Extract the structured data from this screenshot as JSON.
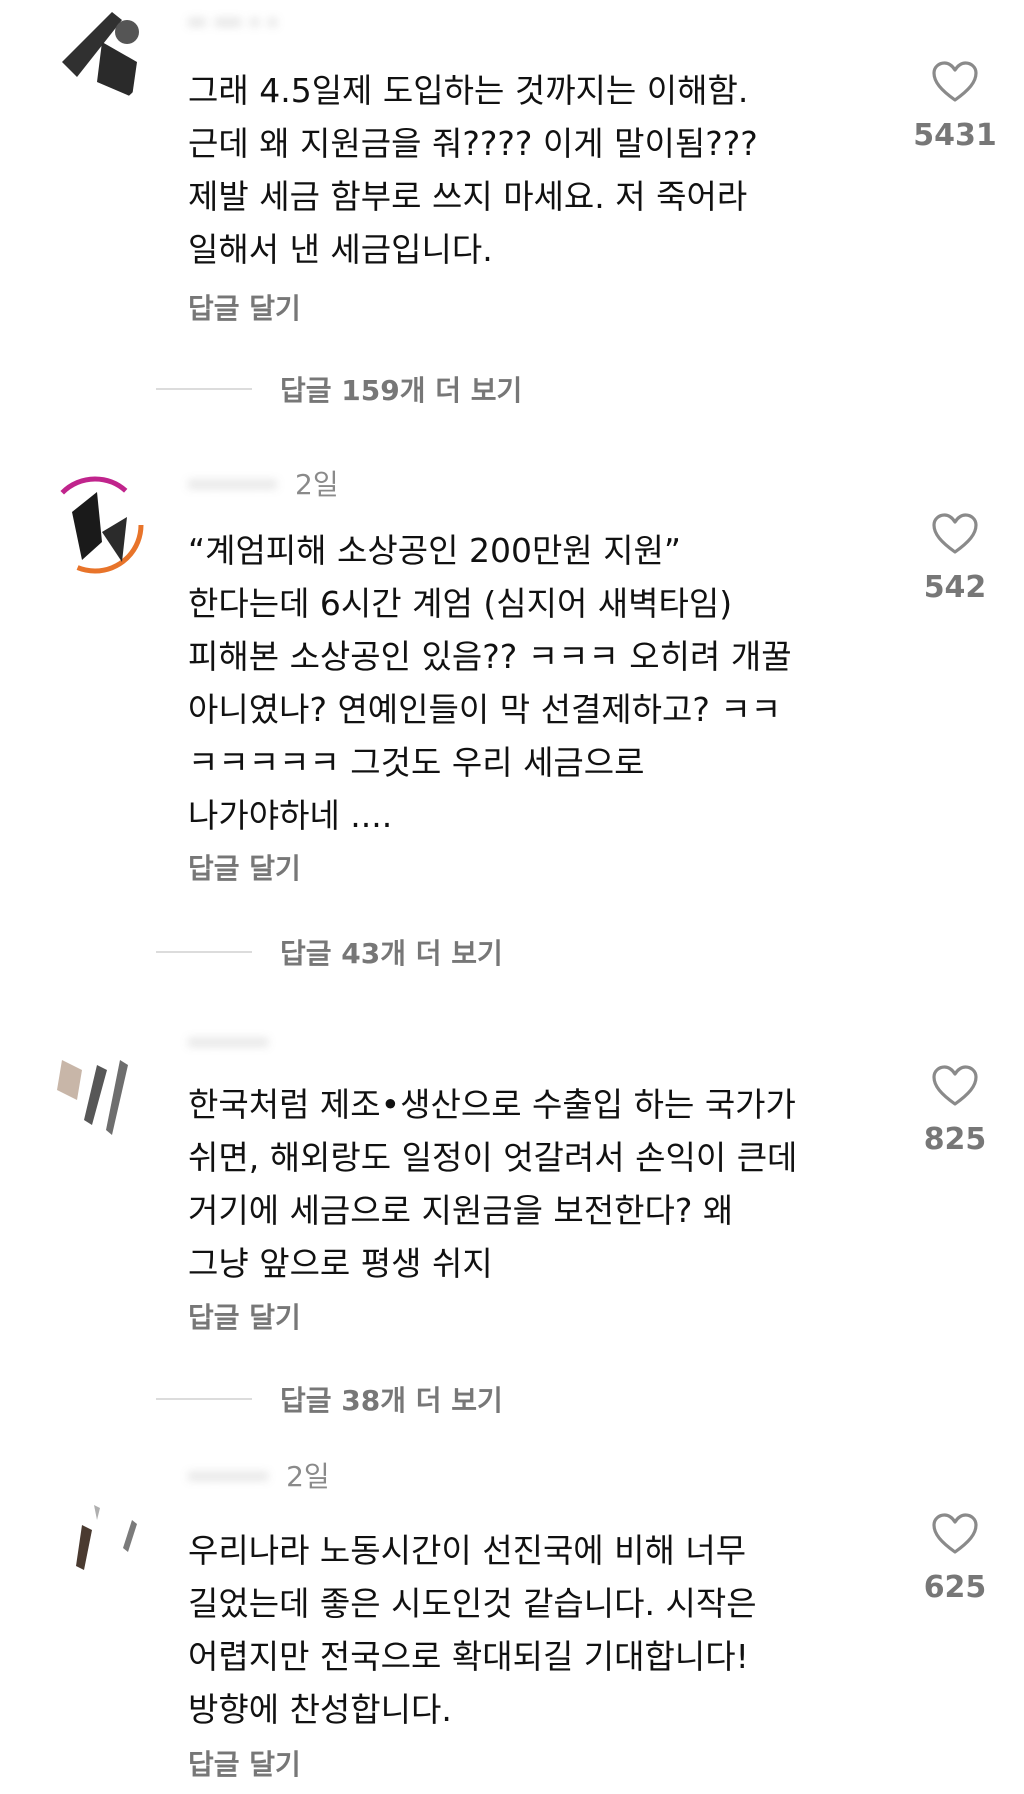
{
  "reply_label": "답글 달기",
  "comments": [
    {
      "username": "",
      "time": "",
      "lines": [
        "그래 4.5일제 도입하는 것까지는 이해함.",
        "근데 왜 지원금을 줘???? 이게 말이됨???",
        "제발 세금 함부로 쓰지 마세요. 저 죽어라",
        "일해서 낸 세금입니다."
      ],
      "likes": "5431",
      "more_replies": "답글 159개 더 보기"
    },
    {
      "username": "",
      "time": "2일",
      "lines": [
        "“계엄피해 소상공인 200만원 지원”",
        "한다는데 6시간 계엄 (심지어 새벽타임)",
        "피해본 소상공인 있음?? ㅋㅋㅋ 오히려 개꿀",
        "아니였나? 연예인들이 막 선결제하고? ㅋㅋ",
        "ㅋㅋㅋㅋㅋ 그것도 우리 세금으로",
        "나가야하네 ...."
      ],
      "likes": "542",
      "more_replies": "답글 43개 더 보기"
    },
    {
      "username": "",
      "time": "",
      "lines": [
        "한국처럼 제조•생산으로 수출입 하는 국가가",
        "쉬면, 해외랑도 일정이 엇갈려서 손익이 큰데",
        "거기에 세금으로 지원금을 보전한다? 왜",
        "그냥 앞으로 평생 쉬지"
      ],
      "likes": "825",
      "more_replies": "답글 38개 더 보기"
    },
    {
      "username": "",
      "time": "2일",
      "lines": [
        "우리나라 노동시간이 선진국에 비해 너무",
        "길었는데 좋은 시도인것 같습니다. 시작은",
        "어렵지만 전국으로 확대되길 기대합니다!",
        "방향에 찬성합니다."
      ],
      "likes": "625",
      "more_replies": ""
    }
  ],
  "colors": {
    "text": "#111111",
    "muted": "#777777",
    "divider": "#dcdcdc",
    "background": "#ffffff"
  },
  "icons": {
    "like": "heart-outline-icon",
    "avatar": "avatar-image"
  }
}
